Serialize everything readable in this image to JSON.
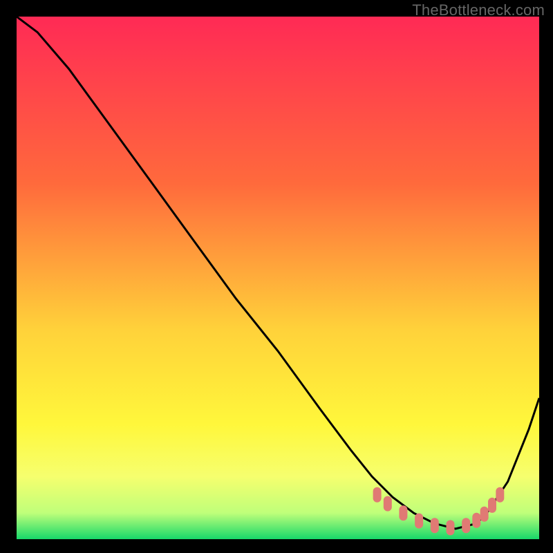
{
  "watermark": "TheBottleneck.com",
  "colors": {
    "top": "#ff2a55",
    "mid1": "#ff6a3c",
    "mid2": "#ffd23a",
    "mid3": "#fff73b",
    "low1": "#f6ff6e",
    "low2": "#bfff7a",
    "bottom": "#17d86a",
    "curve": "#000000",
    "marker": "#e07a74"
  },
  "chart_data": {
    "type": "line",
    "title": "",
    "xlabel": "",
    "ylabel": "",
    "xlim": [
      0,
      100
    ],
    "ylim": [
      0,
      100
    ],
    "x": [
      0,
      4,
      10,
      18,
      26,
      34,
      42,
      50,
      58,
      64,
      68,
      72,
      76,
      80,
      84,
      88,
      90,
      94,
      98,
      100
    ],
    "y": [
      100,
      97,
      90,
      79,
      68,
      57,
      46,
      36,
      25,
      17,
      12,
      8,
      5,
      3,
      2,
      3,
      5,
      11,
      21,
      27
    ],
    "marker_points": [
      {
        "x": 69,
        "y": 8.5
      },
      {
        "x": 71,
        "y": 6.8
      },
      {
        "x": 74,
        "y": 5.0
      },
      {
        "x": 77,
        "y": 3.5
      },
      {
        "x": 80,
        "y": 2.6
      },
      {
        "x": 83,
        "y": 2.2
      },
      {
        "x": 86,
        "y": 2.6
      },
      {
        "x": 88,
        "y": 3.6
      },
      {
        "x": 89.5,
        "y": 4.8
      },
      {
        "x": 91,
        "y": 6.5
      },
      {
        "x": 92.5,
        "y": 8.5
      }
    ]
  }
}
